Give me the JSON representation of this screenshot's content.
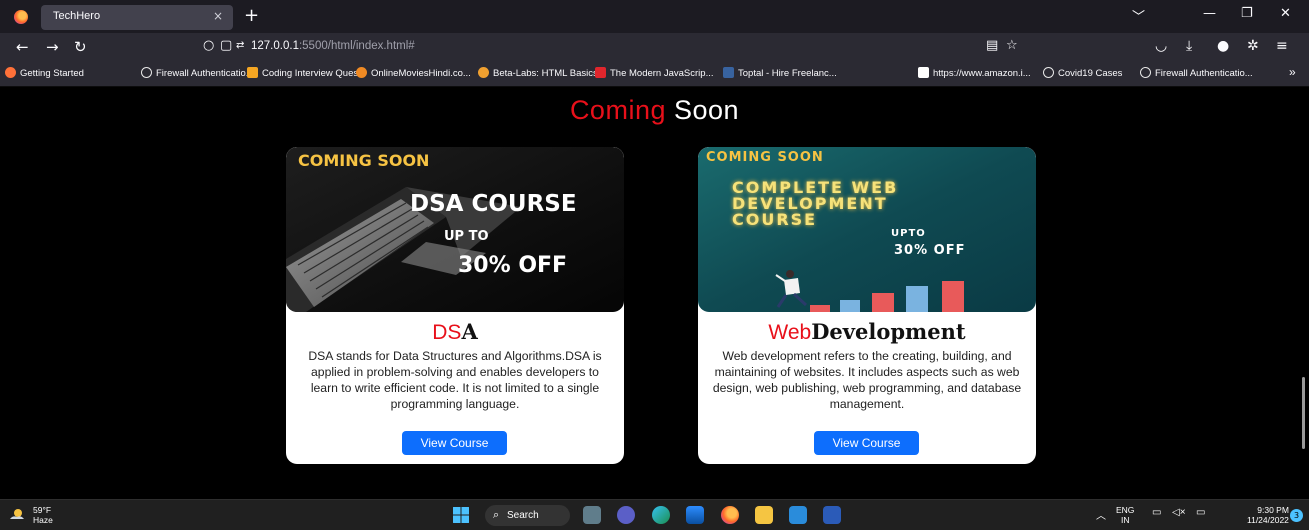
{
  "browser": {
    "tab_title": "TechHero",
    "tab_close": "×",
    "new_tab": "+",
    "url_host": "127.0.0.1",
    "url_rest": ":5500/html/index.html#",
    "icons": [
      "firefox-logo",
      "back-arrow",
      "forward-arrow",
      "reload",
      "shield",
      "page",
      "permissions",
      "reader-view",
      "star",
      "pocket",
      "download",
      "account",
      "extensions",
      "menu"
    ]
  },
  "bookmarks": [
    {
      "label": "Getting Started",
      "color": "#ff7139"
    },
    {
      "label": "Firewall Authenticatio...",
      "color": "#e8e8e8"
    },
    {
      "label": "Coding Interview Ques...",
      "color": "#f5a623"
    },
    {
      "label": "OnlineMoviesHindi.co...",
      "color": "#f08a24"
    },
    {
      "label": "Beta-Labs: HTML Basics",
      "color": "#f0a030"
    },
    {
      "label": "The Modern JavaScrip...",
      "color": "#e0262d"
    },
    {
      "label": "Toptal - Hire Freelanc...",
      "color": "#3863a0"
    },
    {
      "label": "https://www.amazon.i...",
      "color": "#ffffff"
    },
    {
      "label": "Covid19 Cases",
      "color": "#e8e8e8"
    },
    {
      "label": "Firewall Authenticatio...",
      "color": "#e8e8e8"
    }
  ],
  "bookmarks_more": "»",
  "page": {
    "section_title_red": "Coming",
    "section_title_white": "Soon",
    "cards": [
      {
        "image": {
          "badge": "COMING SOON",
          "line1": "DSA COURSE",
          "line2": "UP TO",
          "line3": "30% OFF"
        },
        "title_red": "DS",
        "title_black": "A",
        "description": "DSA stands for Data Structures and Algorithms.DSA is applied in problem-solving and enables developers to learn to write efficient code. It is not limited to a single programming language.",
        "button": "View Course"
      },
      {
        "image": {
          "badge": "COMING SOON",
          "line1": "COMPLETE WEB",
          "line2": "DEVELOPMENT",
          "line3": "COURSE",
          "line4": "UPTO",
          "line5": "30% OFF"
        },
        "title_red": "Web",
        "title_black": "Development",
        "description": "Web development refers to the creating, building, and maintaining of websites. It includes aspects such as web design, web publishing, web programming, and database management.",
        "button": "View Course"
      }
    ]
  },
  "taskbar": {
    "temp": "59°F",
    "condition": "Haze",
    "search": "Search",
    "lang_top": "ENG",
    "lang_bottom": "IN",
    "time": "9:30 PM",
    "date": "11/24/2022",
    "notif_count": "3"
  },
  "colors": {
    "accent_red": "#e8101a",
    "button_blue": "#0d6efd",
    "badge_yellow": "#f6c343"
  }
}
